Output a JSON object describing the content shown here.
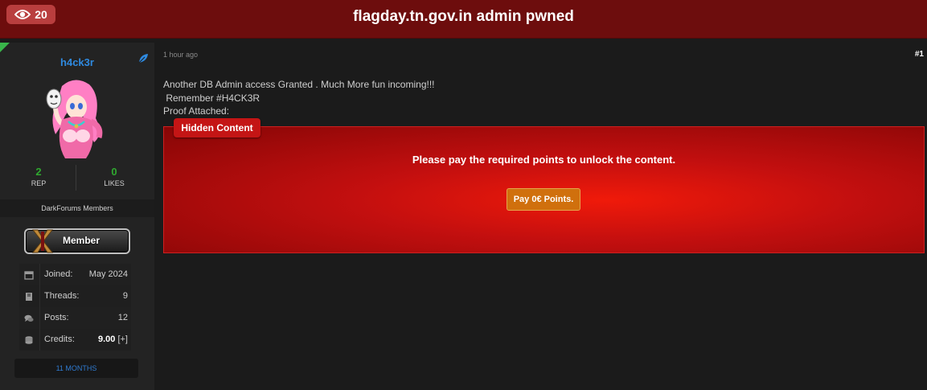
{
  "header": {
    "views": "20",
    "title": "flagday.tn.gov.in admin pwned"
  },
  "author": {
    "username": "h4ck3r",
    "rep": "2",
    "rep_label": "REP",
    "likes": "0",
    "likes_label": "LIKES",
    "group": "DarkForums Members",
    "badge": "Member",
    "info": [
      {
        "label": "Joined:",
        "value": "May 2024",
        "icon": "calendar-icon"
      },
      {
        "label": "Threads:",
        "value": "9",
        "icon": "book-icon"
      },
      {
        "label": "Posts:",
        "value": "12",
        "icon": "comments-icon"
      },
      {
        "label": "Credits:",
        "value": "9.00",
        "extra": "[+]",
        "icon": "coins-icon"
      }
    ],
    "membership": "11 MONTHS"
  },
  "post": {
    "time": "1 hour ago",
    "number": "#1",
    "lines": [
      "Another DB Admin access Granted . Much More fun incoming!!!",
      " Remember #H4CK3R",
      "Proof Attached:"
    ],
    "hidden_label": "Hidden Content",
    "unlock_message": "Please pay the required points to unlock the content.",
    "pay_button": "Pay 0€ Points."
  },
  "colors": {
    "header_bg": "#6d0d0d",
    "username": "#2f8ae0",
    "stat_green": "#2fa82f",
    "hidden_red": "#c41515",
    "pay_orange": "#d0700d"
  }
}
